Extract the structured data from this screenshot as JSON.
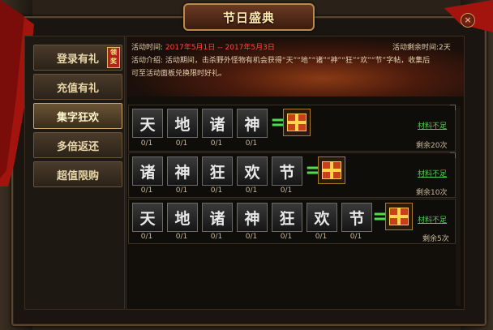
{
  "window": {
    "title": "节日盛典",
    "close_glyph": "×"
  },
  "sidebar": {
    "badge": "领奖",
    "items": [
      {
        "label": "登录有礼",
        "active": false,
        "badge": true
      },
      {
        "label": "充值有礼",
        "active": false,
        "badge": false
      },
      {
        "label": "集字狂欢",
        "active": true,
        "badge": false
      },
      {
        "label": "多倍返还",
        "active": false,
        "badge": false
      },
      {
        "label": "超值限购",
        "active": false,
        "badge": false
      }
    ]
  },
  "banner": {
    "time_label": "活动时间:",
    "time_value": "2017年5月1日 -- 2017年5月3日",
    "remaining_label": "活动剩余时间:",
    "remaining_value": "2天",
    "intro_label": "活动介绍:",
    "intro_line1": "活动期间，击杀野外怪物有机会获得“天”“地”“诸”“神”“狂”“欢”“节”字帖，收集后",
    "intro_line2": "可至活动面板兑换限时好礼。"
  },
  "rows": [
    {
      "chars": [
        "天",
        "地",
        "诸",
        "神"
      ],
      "counts": [
        "0/1",
        "0/1",
        "0/1",
        "0/1"
      ],
      "eq": "=",
      "status": "材料不足",
      "remaining": "剩余20次"
    },
    {
      "chars": [
        "诸",
        "神",
        "狂",
        "欢",
        "节"
      ],
      "counts": [
        "0/1",
        "0/1",
        "0/1",
        "0/1",
        "0/1"
      ],
      "eq": "=",
      "status": "材料不足",
      "remaining": "剩余10次"
    },
    {
      "chars": [
        "天",
        "地",
        "诸",
        "神",
        "狂",
        "欢",
        "节"
      ],
      "counts": [
        "0/1",
        "0/1",
        "0/1",
        "0/1",
        "0/1",
        "0/1",
        "0/1"
      ],
      "eq": "=",
      "status": "材料不足",
      "remaining": "剩余5次"
    }
  ],
  "icons": {
    "gift": "gift-box-icon",
    "close": "close-icon"
  },
  "colors": {
    "accent_green": "#41d341",
    "accent_red": "#ff4a3a",
    "gold": "#c8a66a"
  }
}
